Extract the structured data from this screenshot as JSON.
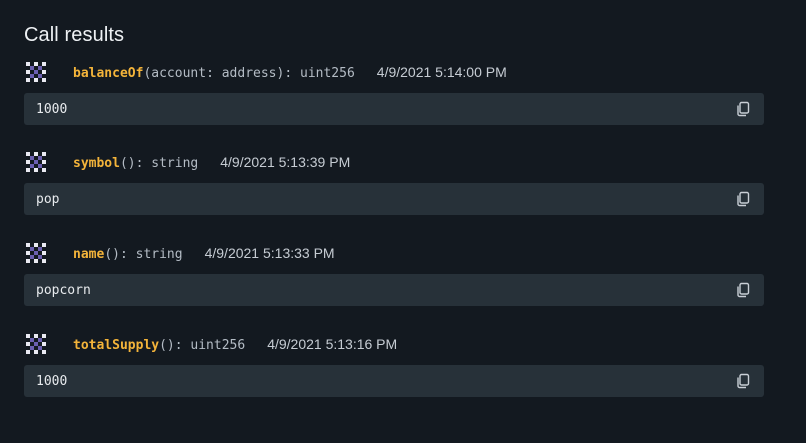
{
  "title": "Call results",
  "calls": [
    {
      "function": "balanceOf",
      "signature_rest": "(account: address): uint256",
      "timestamp": "4/9/2021 5:14:00 PM",
      "result": "1000",
      "copy_icon": "copy-icon"
    },
    {
      "function": "symbol",
      "signature_rest": "(): string",
      "timestamp": "4/9/2021 5:13:39 PM",
      "result": "pop",
      "copy_icon": "copy-icon"
    },
    {
      "function": "name",
      "signature_rest": "(): string",
      "timestamp": "4/9/2021 5:13:33 PM",
      "result": "popcorn",
      "copy_icon": "copy-icon"
    },
    {
      "function": "totalSupply",
      "signature_rest": "(): uint256",
      "timestamp": "4/9/2021 5:13:16 PM",
      "result": "1000",
      "copy_icon": "copy-icon"
    }
  ],
  "colors": {
    "background": "#131920",
    "result_box": "#273139",
    "function_name": "#f4b43a",
    "signature": "#b4bcc5"
  }
}
